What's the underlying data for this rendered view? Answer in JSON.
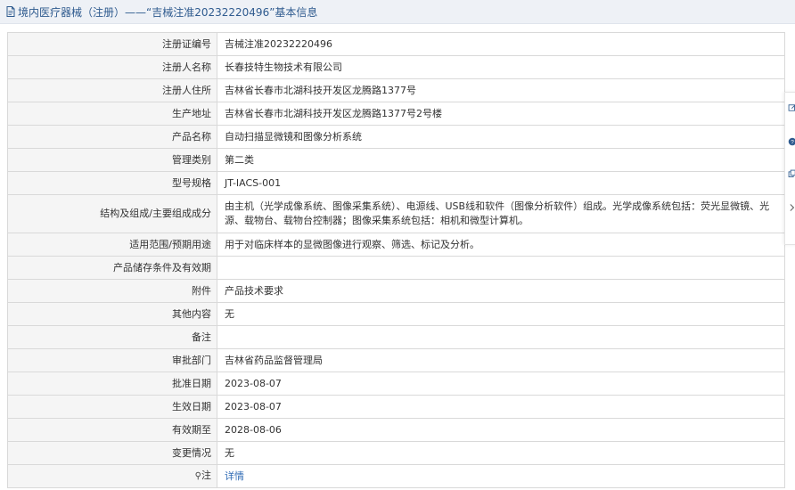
{
  "header": {
    "title": "境内医疗器械（注册）——“吉械注准20232220496”基本信息"
  },
  "icons": {
    "header": "document-icon",
    "remark_pin": "map-pin-icon",
    "sidebar": [
      "edit-icon",
      "help-icon",
      "copy-icon",
      "chevron-right-icon"
    ]
  },
  "colors": {
    "header_bg": "#eef1f6",
    "header_text": "#2f5b8f",
    "label_bg": "#f5f5f5",
    "border": "#d9d9d9",
    "link": "#2f6bb5"
  },
  "rows": [
    {
      "label": "注册证编号",
      "value": "吉械注准20232220496"
    },
    {
      "label": "注册人名称",
      "value": "长春技特生物技术有限公司"
    },
    {
      "label": "注册人住所",
      "value": "吉林省长春市北湖科技开发区龙腾路1377号"
    },
    {
      "label": "生产地址",
      "value": "吉林省长春市北湖科技开发区龙腾路1377号2号楼"
    },
    {
      "label": "产品名称",
      "value": "自动扫描显微镜和图像分析系统"
    },
    {
      "label": "管理类别",
      "value": "第二类"
    },
    {
      "label": "型号规格",
      "value": "JT-IACS-001"
    },
    {
      "label": "结构及组成/主要组成成分",
      "value": "由主机（光学成像系统、图像采集系统）、电源线、USB线和软件（图像分析软件）组成。光学成像系统包括：荧光显微镜、光源、载物台、载物台控制器；图像采集系统包括：相机和微型计算机。"
    },
    {
      "label": "适用范围/预期用途",
      "value": "用于对临床样本的显微图像进行观察、筛选、标记及分析。"
    },
    {
      "label": "产品储存条件及有效期",
      "value": ""
    },
    {
      "label": "附件",
      "value": "产品技术要求"
    },
    {
      "label": "其他内容",
      "value": "无"
    },
    {
      "label": "备注",
      "value": ""
    },
    {
      "label": "审批部门",
      "value": "吉林省药品监督管理局"
    },
    {
      "label": "批准日期",
      "value": "2023-08-07"
    },
    {
      "label": "生效日期",
      "value": "2023-08-07"
    },
    {
      "label": "有效期至",
      "value": "2028-08-06"
    },
    {
      "label": "变更情况",
      "value": "无"
    },
    {
      "label": "注",
      "value": "详情"
    }
  ]
}
